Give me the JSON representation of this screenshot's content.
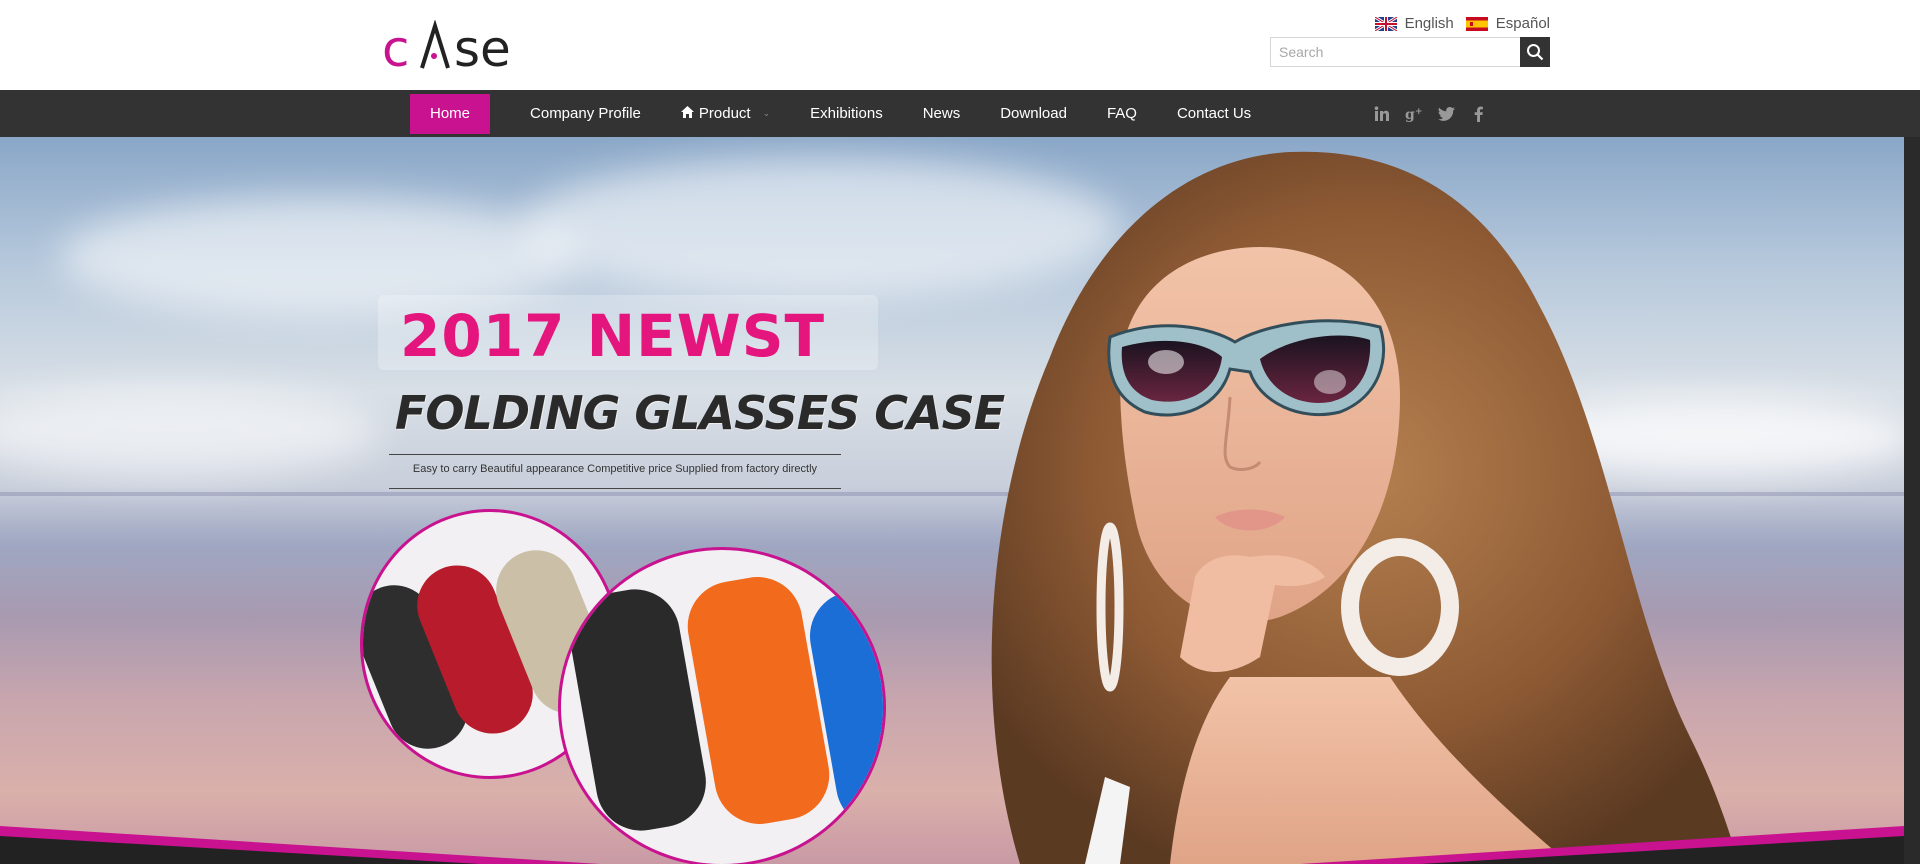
{
  "header": {
    "logo_text": "cAse",
    "languages": [
      {
        "label": "English",
        "flag": "uk-flag-icon"
      },
      {
        "label": "Español",
        "flag": "spain-flag-icon"
      }
    ],
    "search": {
      "placeholder": "Search",
      "icon": "search-icon"
    }
  },
  "nav": {
    "items": [
      {
        "label": "Home",
        "active": true
      },
      {
        "label": "Company Profile"
      },
      {
        "label": "Product",
        "icon": "home-icon",
        "dropdown": true
      },
      {
        "label": "Exhibitions"
      },
      {
        "label": "News"
      },
      {
        "label": "Download"
      },
      {
        "label": "FAQ"
      },
      {
        "label": "Contact Us"
      }
    ],
    "social": [
      "linkedin-icon",
      "google-plus-icon",
      "twitter-icon",
      "facebook-icon"
    ]
  },
  "hero": {
    "headline": "2017  NEWST",
    "subheadline": "FOLDING GLASSES CASE",
    "tagline": "Easy to carry  Beautiful appearance  Competitive price  Supplied from factory directly"
  },
  "colors": {
    "accent": "#c8128f",
    "headline": "#e5157e",
    "nav_bg": "#333333"
  }
}
